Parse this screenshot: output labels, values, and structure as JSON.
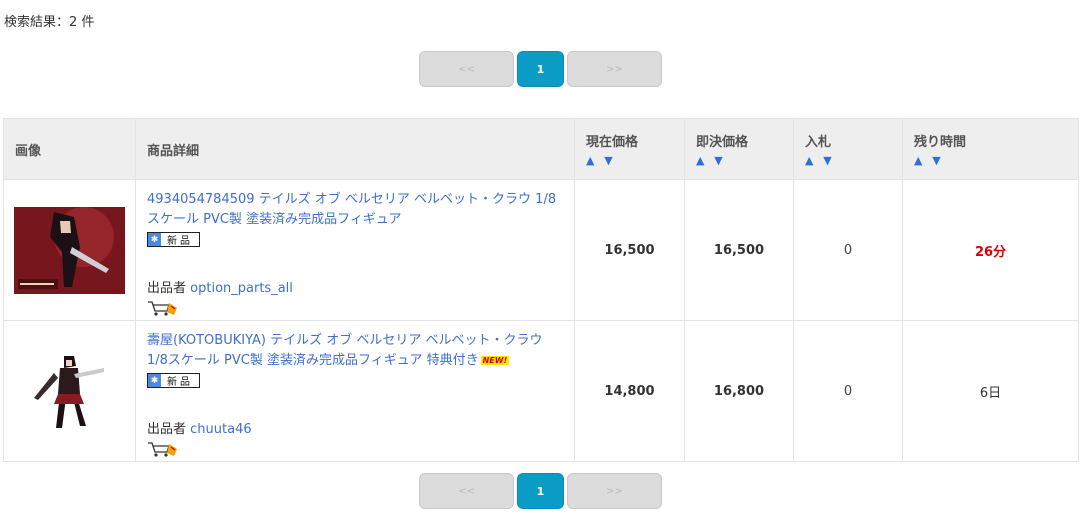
{
  "result_count": "検索結果：2 件",
  "pagination": {
    "prev": "<<",
    "current": "1",
    "next": ">>"
  },
  "table": {
    "headers": {
      "image": "画像",
      "detail": "商品詳細",
      "current_price": "現在価格",
      "buyout_price": "即決価格",
      "bids": "入札",
      "remaining": "残り時間"
    },
    "sort_arrows": "▲ ▼",
    "rows": [
      {
        "title": "4934054784509 テイルズ オブ ベルセリア ベルベット・クラウ 1/8スケール PVC製 塗装済み完成品フィギュア",
        "condition": "新品",
        "seller_label": "出品者",
        "seller": "option_parts_all",
        "current_price": "16,500",
        "buyout_price": "16,500",
        "bids": "0",
        "remaining": "26分",
        "is_new": false
      },
      {
        "title": "壽屋(KOTOBUKIYA) テイルズ オブ ベルセリア ベルベット・クラウ 1/8スケール PVC製 塗装済み完成品フィギュア 特典付き",
        "condition": "新品",
        "seller_label": "出品者",
        "seller": "chuuta46",
        "current_price": "14,800",
        "buyout_price": "16,800",
        "bids": "0",
        "remaining": "6日",
        "is_new": true,
        "new_badge": "NEW!"
      }
    ]
  },
  "colors": {
    "accent": "#0b9cc6",
    "link": "#3e6fd1",
    "urgent": "#d90000"
  }
}
